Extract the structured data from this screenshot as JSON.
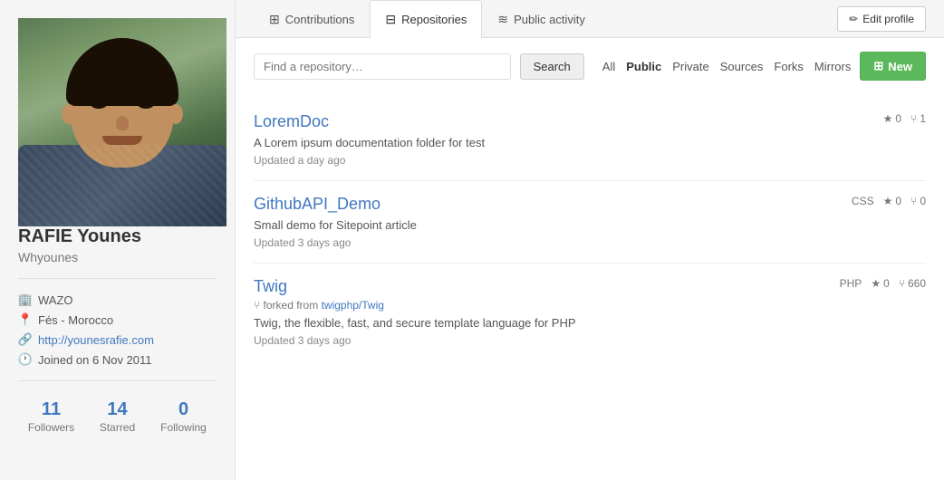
{
  "sidebar": {
    "user_name": "RAFIE Younes",
    "user_handle": "Whyounes",
    "meta": {
      "company": "WAZO",
      "location": "Fés - Morocco",
      "website": "http://younesrafie.com",
      "joined": "Joined on 6 Nov 2011"
    },
    "stats": {
      "followers": {
        "count": "11",
        "label": "Followers"
      },
      "starred": {
        "count": "14",
        "label": "Starred"
      },
      "following": {
        "count": "0",
        "label": "Following"
      }
    }
  },
  "tabs": [
    {
      "id": "contributions",
      "label": "Contributions",
      "icon": "⊞",
      "active": false
    },
    {
      "id": "repositories",
      "label": "Repositories",
      "icon": "⊟",
      "active": true
    },
    {
      "id": "public-activity",
      "label": "Public activity",
      "icon": "≋",
      "active": false
    }
  ],
  "edit_profile": "Edit profile",
  "repo_section": {
    "search_placeholder": "Find a repository…",
    "search_button": "Search",
    "filters": [
      {
        "id": "all",
        "label": "All",
        "active": false
      },
      {
        "id": "public",
        "label": "Public",
        "active": true
      },
      {
        "id": "private",
        "label": "Private",
        "active": false
      },
      {
        "id": "sources",
        "label": "Sources",
        "active": false
      },
      {
        "id": "forks",
        "label": "Forks",
        "active": false
      },
      {
        "id": "mirrors",
        "label": "Mirrors",
        "active": false
      }
    ],
    "new_button": "New",
    "repositories": [
      {
        "id": "loremdoc",
        "name": "LoremDoc",
        "description": "A Lorem ipsum documentation folder for test",
        "updated": "Updated a day ago",
        "language": null,
        "stars": "0",
        "forks": "1",
        "fork_source": null
      },
      {
        "id": "githubapi-demo",
        "name": "GithubAPI_Demo",
        "description": "Small demo for Sitepoint article",
        "updated": "Updated 3 days ago",
        "language": "CSS",
        "stars": "0",
        "forks": "0",
        "fork_source": null
      },
      {
        "id": "twig",
        "name": "Twig",
        "description": "Twig, the flexible, fast, and secure template language for PHP",
        "updated": "Updated 3 days ago",
        "language": "PHP",
        "stars": "0",
        "forks": "660",
        "fork_source": "twigphp/Twig",
        "fork_source_url": "twigphp/Twig"
      }
    ]
  },
  "icons": {
    "pencil": "✏",
    "building": "🏢",
    "pin": "📍",
    "link": "🔗",
    "clock": "🕐",
    "star": "★",
    "fork": "⑂",
    "new_plus": "⊞"
  }
}
